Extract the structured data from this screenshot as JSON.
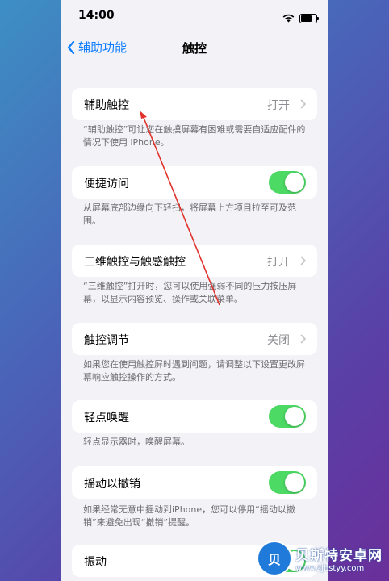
{
  "status_bar": {
    "time": "14:00"
  },
  "nav": {
    "back_label": "辅助功能",
    "title": "触控"
  },
  "rows": [
    {
      "label": "辅助触控",
      "value": "打开",
      "control": "chevron",
      "footnote": "“辅助触控”可让您在触摸屏幕有困难或需要自适应配件的情况下使用 iPhone。"
    },
    {
      "label": "便捷访问",
      "control": "toggle",
      "state": "on",
      "footnote": "从屏幕底部边缘向下轻扫，将屏幕上方项目拉至可及范围。"
    },
    {
      "label": "三维触控与触感触控",
      "value": "打开",
      "control": "chevron",
      "footnote": "“三维触控”打开时，您可以使用强弱不同的压力按压屏幕，以显示内容预览、操作或关联菜单。"
    },
    {
      "label": "触控调节",
      "value": "关闭",
      "control": "chevron",
      "footnote": "如果您在使用触控屏时遇到问题，请调整以下设置更改屏幕响应触控操作的方式。"
    },
    {
      "label": "轻点唤醒",
      "control": "toggle",
      "state": "on",
      "footnote": "轻点显示器时，唤醒屏幕。"
    },
    {
      "label": "摇动以撤销",
      "control": "toggle",
      "state": "on",
      "footnote": "如果经常无意中摇动到iPhone，您可以停用“摇动以撤销”来避免出现“撤销”提醒。"
    },
    {
      "label": "振动",
      "control": "toggle",
      "state": "on"
    }
  ],
  "colors": {
    "accent": "#0a7cff",
    "toggle_on": "#4cd964",
    "annotation": "#e0312a"
  },
  "watermark": {
    "name": "贝斯特安卓网",
    "url": "www.zjbstyy.com",
    "logo_glyph": "贝"
  }
}
